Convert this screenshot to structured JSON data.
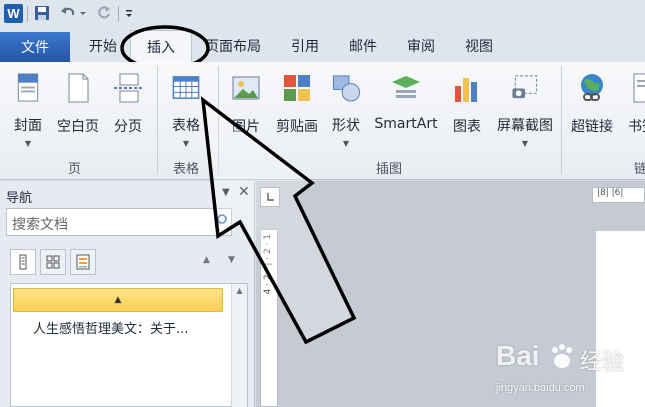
{
  "qat": {
    "logo_letter": "W"
  },
  "tabs": {
    "file": "文件",
    "items": [
      "开始",
      "插入",
      "页面布局",
      "引用",
      "邮件",
      "审阅",
      "视图"
    ]
  },
  "ribbon": {
    "buttons": {
      "cover": "封面",
      "blank_page": "空白页",
      "page_break": "分页",
      "table": "表格",
      "picture": "图片",
      "clipart": "剪贴画",
      "shapes": "形状",
      "smartart": "SmartArt",
      "chart": "图表",
      "screenshot": "屏幕截图",
      "hyperlink": "超链接",
      "bookmark": "书签"
    },
    "groups": {
      "pages": "页",
      "tables": "表格",
      "illustrations": "插图",
      "links": "链"
    }
  },
  "nav": {
    "title": "导航",
    "search_placeholder": "搜索文档",
    "heading_item": "人生感悟哲理美文：关于..."
  },
  "ruler": {
    "horizontal": "|8| |6|",
    "vertical": "4 · 2 · | · 2 · 1"
  },
  "watermark": {
    "brand": "Bai",
    "brand2": "经验",
    "url": "jingyan.baidu.com"
  },
  "colors": {
    "file_tab": "#2b63b4",
    "accent": "#1f5fb0",
    "heading_highlight": "#f8cf52"
  }
}
